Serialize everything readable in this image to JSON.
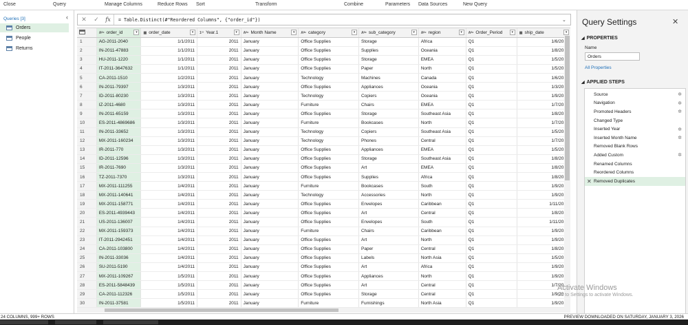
{
  "ribbon": {
    "groups": [
      "Close",
      "Query",
      "Manage Columns",
      "Reduce Rows",
      "Sort",
      "Transform",
      "Combine",
      "Parameters",
      "Data Sources",
      "New Query"
    ]
  },
  "queries": {
    "header": "Queries [3]",
    "items": [
      "Orders",
      "People",
      "Returns"
    ]
  },
  "formula_bar": {
    "fx": "fx",
    "formula": "= Table.Distinct(#\"Reordered Columns\", {\"order_id\"})"
  },
  "grid": {
    "columns": [
      {
        "name": "order_id",
        "type": "ABC"
      },
      {
        "name": "order_date",
        "type": "DATE"
      },
      {
        "name": "Year.1",
        "type": "123"
      },
      {
        "name": "Month Name",
        "type": "ABC"
      },
      {
        "name": "category",
        "type": "ABC"
      },
      {
        "name": "sub_category",
        "type": "ABC"
      },
      {
        "name": "region",
        "type": "ABC"
      },
      {
        "name": "Order_Period",
        "type": "ABC123"
      },
      {
        "name": "ship_date",
        "type": "DATE"
      },
      {
        "name": "ship_",
        "type": "ABC"
      }
    ],
    "rows": [
      [
        "1",
        "AG-2011-2040",
        "1/1/2011",
        "2011",
        "January",
        "Office Supplies",
        "Storage",
        "Africa",
        "Q1",
        "1/6/2011",
        "Standa"
      ],
      [
        "2",
        "IN-2011-47883",
        "1/1/2011",
        "2011",
        "January",
        "Office Supplies",
        "Supplies",
        "Oceania",
        "Q1",
        "1/8/2011",
        "Standa"
      ],
      [
        "3",
        "HU-2011-1220",
        "1/1/2011",
        "2011",
        "January",
        "Office Supplies",
        "Storage",
        "EMEA",
        "Q1",
        "1/5/2011",
        "Second"
      ],
      [
        "4",
        "IT-2011-3647632",
        "1/1/2011",
        "2011",
        "January",
        "Office Supplies",
        "Paper",
        "North",
        "Q1",
        "1/5/2011",
        "Second"
      ],
      [
        "5",
        "CA-2011-1510",
        "1/2/2011",
        "2011",
        "January",
        "Technology",
        "Machines",
        "Canada",
        "Q1",
        "1/6/2011",
        "Standa"
      ],
      [
        "6",
        "IN-2011-79397",
        "1/3/2011",
        "2011",
        "January",
        "Office Supplies",
        "Appliances",
        "Oceania",
        "Q1",
        "1/3/2011",
        "Same D"
      ],
      [
        "7",
        "ID-2011-80230",
        "1/3/2011",
        "2011",
        "January",
        "Technology",
        "Copiers",
        "Oceania",
        "Q1",
        "1/9/2011",
        "Standa"
      ],
      [
        "8",
        "IZ-2011-4680",
        "1/3/2011",
        "2011",
        "January",
        "Furniture",
        "Chairs",
        "EMEA",
        "Q1",
        "1/7/2011",
        "Standa"
      ],
      [
        "9",
        "IN-2011-65159",
        "1/3/2011",
        "2011",
        "January",
        "Office Supplies",
        "Storage",
        "Southeast Asia",
        "Q1",
        "1/8/2011",
        "Standa"
      ],
      [
        "10",
        "ES-2011-4869686",
        "1/3/2011",
        "2011",
        "January",
        "Furniture",
        "Bookcases",
        "North",
        "Q1",
        "1/7/2011",
        "Standa"
      ],
      [
        "11",
        "IN-2011-33652",
        "1/3/2011",
        "2011",
        "January",
        "Technology",
        "Copiers",
        "Southeast Asia",
        "Q1",
        "1/5/2011",
        "Second"
      ],
      [
        "12",
        "MX-2011-160234",
        "1/3/2011",
        "2011",
        "January",
        "Technology",
        "Phones",
        "Central",
        "Q1",
        "1/7/2011",
        "Standa"
      ],
      [
        "13",
        "IR-2011-770",
        "1/3/2011",
        "2011",
        "January",
        "Office Supplies",
        "Appliances",
        "EMEA",
        "Q1",
        "1/5/2011",
        "Second"
      ],
      [
        "14",
        "ID-2011-12596",
        "1/3/2011",
        "2011",
        "January",
        "Office Supplies",
        "Storage",
        "Southeast Asia",
        "Q1",
        "1/8/2011",
        "Standa"
      ],
      [
        "15",
        "IR-2011-7690",
        "1/3/2011",
        "2011",
        "January",
        "Office Supplies",
        "Art",
        "EMEA",
        "Q1",
        "1/8/2011",
        "Standa"
      ],
      [
        "16",
        "TZ-2011-7370",
        "1/3/2011",
        "2011",
        "January",
        "Office Supplies",
        "Supplies",
        "Africa",
        "Q1",
        "1/8/2011",
        "Standa"
      ],
      [
        "17",
        "MX-2011-111255",
        "1/4/2011",
        "2011",
        "January",
        "Furniture",
        "Bookcases",
        "South",
        "Q1",
        "1/9/2011",
        "Second"
      ],
      [
        "18",
        "MX-2011-140641",
        "1/4/2011",
        "2011",
        "January",
        "Technology",
        "Accessories",
        "North",
        "Q1",
        "1/9/2011",
        "Standa"
      ],
      [
        "19",
        "MX-2011-158771",
        "1/4/2011",
        "2011",
        "January",
        "Office Supplies",
        "Envelopes",
        "Caribbean",
        "Q1",
        "1/11/2011",
        "Standa"
      ],
      [
        "20",
        "ES-2011-4939443",
        "1/4/2011",
        "2011",
        "January",
        "Office Supplies",
        "Art",
        "Central",
        "Q1",
        "1/8/2011",
        "Standa"
      ],
      [
        "21",
        "US-2011-136007",
        "1/4/2011",
        "2011",
        "January",
        "Office Supplies",
        "Envelopes",
        "South",
        "Q1",
        "1/11/2011",
        "Standa"
      ],
      [
        "22",
        "MX-2011-159373",
        "1/4/2011",
        "2011",
        "January",
        "Furniture",
        "Chairs",
        "Caribbean",
        "Q1",
        "1/9/2011",
        "Standa"
      ],
      [
        "23",
        "IT-2011-2942451",
        "1/4/2011",
        "2011",
        "January",
        "Office Supplies",
        "Art",
        "North",
        "Q1",
        "1/9/2011",
        "Standa"
      ],
      [
        "24",
        "CA-2011-103800",
        "1/4/2011",
        "2011",
        "January",
        "Office Supplies",
        "Paper",
        "Central",
        "Q1",
        "1/8/2011",
        "Standa"
      ],
      [
        "25",
        "IN-2011-33036",
        "1/4/2011",
        "2011",
        "January",
        "Office Supplies",
        "Labels",
        "North Asia",
        "Q1",
        "1/5/2011",
        "Second"
      ],
      [
        "26",
        "SU-2011-5190",
        "1/4/2011",
        "2011",
        "January",
        "Office Supplies",
        "Art",
        "Africa",
        "Q1",
        "1/9/2011",
        "Standa"
      ],
      [
        "27",
        "MX-2011-109267",
        "1/5/2011",
        "2011",
        "January",
        "Office Supplies",
        "Appliances",
        "North",
        "Q1",
        "1/9/2011",
        "Standa"
      ],
      [
        "28",
        "ES-2011-5848439",
        "1/5/2011",
        "2011",
        "January",
        "Office Supplies",
        "Art",
        "Central",
        "Q1",
        "1/7/2011",
        "First C"
      ],
      [
        "29",
        "CA-2011-112326",
        "1/5/2011",
        "2011",
        "January",
        "Office Supplies",
        "Storage",
        "Central",
        "Q1",
        "1/9/2011",
        "Standa"
      ],
      [
        "30",
        "IN-2011-37581",
        "1/5/2011",
        "2011",
        "January",
        "Furniture",
        "Furnishings",
        "North Asia",
        "Q1",
        "1/9/2011",
        "Standa"
      ]
    ]
  },
  "settings": {
    "title": "Query Settings",
    "properties_header": "PROPERTIES",
    "name_label": "Name",
    "name_value": "Orders",
    "all_properties": "All Properties",
    "applied_steps_header": "APPLIED STEPS",
    "steps": [
      {
        "label": "Source",
        "gear": true
      },
      {
        "label": "Navigation",
        "gear": true
      },
      {
        "label": "Promoted Headers",
        "gear": true
      },
      {
        "label": "Changed Type",
        "gear": false
      },
      {
        "label": "Inserted Year",
        "gear": true
      },
      {
        "label": "Inserted Month Name",
        "gear": true
      },
      {
        "label": "Removed Blank Rows",
        "gear": false
      },
      {
        "label": "Added Custom",
        "gear": true
      },
      {
        "label": "Renamed Columns",
        "gear": false
      },
      {
        "label": "Reordered Columns",
        "gear": false
      },
      {
        "label": "Removed Duplicates",
        "gear": false,
        "selected": true
      }
    ]
  },
  "watermark": {
    "line1": "Activate Windows",
    "line2": "Go to Settings to activate Windows."
  },
  "status": {
    "left": "24 COLUMNS, 999+ ROWS",
    "right": "PREVIEW DOWNLOADED ON SATURDAY, JANUARY 3, 2026"
  },
  "colors": {
    "selected_column": "#dff0e3",
    "link": "#1e6fb8"
  }
}
